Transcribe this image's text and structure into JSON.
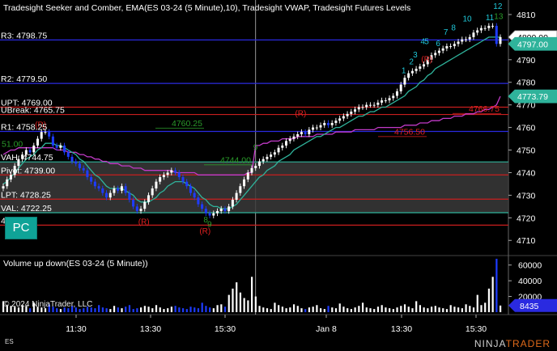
{
  "chart_title": "Tradesight Seeker and Comber, EMA(ES 03-24 (5 Minute),10), Tradesight VWAP, Tradesight Futures Levels",
  "volume_title": "Volume up down(ES 03-24 (5 Minute))",
  "copyright": "© 2024 NinjaTrader, LLC",
  "instrument": "ES",
  "brand_prefix": "NINJA",
  "brand_suffix": "TRADER",
  "pc_badge": "PC",
  "colors": {
    "background": "#000000",
    "up_bar": "#ffffff",
    "down_bar": "#1e3cff",
    "ema": "#2fb39b",
    "vwap": "#c23ac8",
    "level_blue": "#2a2ae0",
    "level_red": "#c81e1e",
    "value_area_fill": "#3a3a3a",
    "value_area_edge": "#2fb39b",
    "seeker": "#1fc7d8",
    "comber": "#2a9a2a",
    "reversal": "#e02020",
    "last_price_badge": "#2fb39b",
    "level_badge": "#2fb39b",
    "volume_badge": "#2a2ae0"
  },
  "chart_data": {
    "type": "candlestick",
    "price_axis": {
      "range": [
        4704,
        4815
      ],
      "ticks": [
        4710,
        4720,
        4730,
        4740,
        4750,
        4760,
        4770,
        4780,
        4790,
        4800,
        4810
      ],
      "tick_labels": [
        "4710",
        "4720",
        "4730",
        "4740",
        "4750",
        "4760",
        "4770",
        "4780",
        "4790",
        "4800",
        "4810"
      ]
    },
    "volume_axis": {
      "range": [
        0,
        70000
      ],
      "ticks": [
        20000,
        40000,
        60000
      ],
      "tick_labels": [
        "20000",
        "40000",
        "60000"
      ]
    },
    "time_axis": {
      "labels": [
        "11:30",
        "13:30",
        "15:30",
        "Jan 8",
        "13:30",
        "15:30"
      ]
    },
    "price_badges": [
      {
        "text": "4800.00",
        "value": 4800.0,
        "style": "last"
      },
      {
        "text": "4797.00",
        "value": 4797.0,
        "style": "ghost"
      },
      {
        "text": "4773.79",
        "value": 4773.79,
        "style": "level"
      }
    ],
    "volume_badge": {
      "text": "8435",
      "value": 8435
    },
    "levels": [
      {
        "label": "R3: 4798.75",
        "value": 4798.75,
        "color": "blue"
      },
      {
        "label": "R2: 4779.50",
        "value": 4779.5,
        "color": "blue"
      },
      {
        "label": "UPT: 4769.00",
        "value": 4769.0,
        "color": "red"
      },
      {
        "label": "UBreak: 4765.75",
        "value": 4765.75,
        "color": "red"
      },
      {
        "label": "R1: 4758.25",
        "value": 4758.25,
        "color": "blue"
      },
      {
        "label": "VAH: 4744.75",
        "value": 4744.75,
        "color": "teal"
      },
      {
        "label": "Pivot: 4739.00",
        "value": 4739.0,
        "color": "red"
      },
      {
        "label": "LPT: 4728.25",
        "value": 4728.25,
        "color": "red"
      },
      {
        "label": "VAL: 4722.25",
        "value": 4722.25,
        "color": "teal"
      },
      {
        "label": "4716.75",
        "value": 4716.75,
        "color": "red"
      }
    ],
    "annotations": [
      {
        "text": "4760.25",
        "value": 4760.25,
        "color": "green"
      },
      {
        "text": "4744.00",
        "value": 4744.0,
        "color": "green"
      },
      {
        "text": "4756.50",
        "value": 4756.5,
        "color": "red"
      },
      {
        "text": "4766.75",
        "value": 4766.75,
        "color": "red"
      },
      {
        "text": "51.00",
        "value": 4751.0,
        "color": "green"
      }
    ],
    "seeker_counts": [
      {
        "text": "12",
        "bar": 129,
        "value": 4812.5
      },
      {
        "text": "11",
        "bar": 127,
        "value": 4807.5
      },
      {
        "text": "10",
        "bar": 121,
        "value": 4807
      },
      {
        "text": "8",
        "bar": 118,
        "value": 4803
      },
      {
        "text": "7",
        "bar": 116,
        "value": 4801
      },
      {
        "text": "6",
        "bar": 114,
        "value": 4796
      },
      {
        "text": "5",
        "bar": 111,
        "value": 4797
      },
      {
        "text": "4",
        "bar": 110,
        "value": 4797
      },
      {
        "text": "3",
        "bar": 108,
        "value": 4791
      },
      {
        "text": "2",
        "bar": 107,
        "value": 4788
      },
      {
        "text": "1",
        "bar": 105,
        "value": 4784
      }
    ],
    "comber_counts": [
      {
        "text": "13",
        "bar": 129,
        "value": 4808
      },
      {
        "text": "9",
        "bar": 66,
        "value": 4750
      },
      {
        "text": "8",
        "bar": 53,
        "value": 4718
      },
      {
        "text": "9",
        "bar": 54,
        "value": 4716
      }
    ],
    "reversals": [
      {
        "text": "(R)",
        "bar": 10,
        "value": 4760
      },
      {
        "text": "(R)",
        "bar": 37,
        "value": 4717
      },
      {
        "text": "(R)",
        "bar": 53,
        "value": 4713
      },
      {
        "text": "(R)",
        "bar": 78,
        "value": 4765
      },
      {
        "text": "(R)",
        "bar": 111,
        "value": 4789
      }
    ],
    "session_divider_bar": 66,
    "bar_count": 131,
    "closes": [
      4734,
      4737,
      4739,
      4743,
      4746,
      4748,
      4750,
      4749,
      4752,
      4755,
      4758,
      4758,
      4756,
      4752,
      4751,
      4752,
      4749,
      4747,
      4745,
      4744,
      4742,
      4741,
      4738,
      4736,
      4734,
      4733,
      4731,
      4729,
      4731,
      4733,
      4732,
      4734,
      4731,
      4728,
      4725,
      4723,
      4724,
      4727,
      4730,
      4733,
      4736,
      4738,
      4739,
      4740,
      4741,
      4740,
      4738,
      4736,
      4734,
      4731,
      4729,
      4726,
      4724,
      4722,
      4721,
      4722,
      4723,
      4724,
      4723,
      4725,
      4728,
      4731,
      4734,
      4737,
      4740,
      4742,
      4743,
      4745,
      4746,
      4747,
      4748,
      4749,
      4751,
      4752,
      4754,
      4755,
      4756,
      4757,
      4758,
      4757,
      4759,
      4760,
      4760,
      4761,
      4762,
      4761,
      4762,
      4763,
      4764,
      4765,
      4766,
      4767,
      4768,
      4769,
      4769,
      4770,
      4770,
      4770,
      4771,
      4772,
      4772,
      4773,
      4774,
      4776,
      4779,
      4782,
      4784,
      4785,
      4786,
      4787,
      4788,
      4790,
      4792,
      4793,
      4794,
      4795,
      4796,
      4796,
      4797,
      4798,
      4799,
      4799,
      4800,
      4802,
      4803,
      4804,
      4804,
      4805,
      4805,
      4797,
      4800
    ],
    "ema_values": [
      4735,
      4736,
      4738,
      4740,
      4742,
      4744,
      4746,
      4747,
      4748,
      4750,
      4751,
      4753,
      4753,
      4753,
      4752,
      4752,
      4751,
      4750,
      4749,
      4748,
      4746,
      4745,
      4743,
      4741,
      4739,
      4738,
      4736,
      4734,
      4733,
      4733,
      4733,
      4733,
      4732,
      4731,
      4730,
      4728,
      4727,
      4727,
      4727,
      4728,
      4729,
      4731,
      4732,
      4734,
      4735,
      4736,
      4736,
      4736,
      4735,
      4734,
      4733,
      4731,
      4729,
      4728,
      4726,
      4725,
      4725,
      4724,
      4724,
      4724,
      4725,
      4726,
      4728,
      4730,
      4732,
      4734,
      4736,
      4738,
      4739,
      4741,
      4742,
      4743,
      4745,
      4746,
      4747,
      4748,
      4750,
      4751,
      4752,
      4753,
      4754,
      4755,
      4756,
      4756,
      4757,
      4758,
      4759,
      4760,
      4760,
      4761,
      4762,
      4763,
      4764,
      4765,
      4765,
      4766,
      4767,
      4767,
      4768,
      4769,
      4769,
      4770,
      4771,
      4772,
      4773,
      4774,
      4776,
      4777,
      4778,
      4780,
      4781,
      4783,
      4784,
      4786,
      4787,
      4788,
      4789,
      4790,
      4791,
      4792,
      4793,
      4794,
      4795,
      4796,
      4797,
      4798,
      4799,
      4800,
      4800,
      4800,
      4800
    ],
    "vwap_values": [
      4748,
      4749,
      4750,
      4750,
      4751,
      4751,
      4751,
      4751,
      4751,
      4751,
      4751,
      4751,
      4751,
      4751,
      4750,
      4750,
      4750,
      4749,
      4749,
      4749,
      4748,
      4748,
      4747,
      4747,
      4746,
      4746,
      4745,
      4745,
      4744,
      4744,
      4744,
      4743,
      4743,
      4743,
      4742,
      4742,
      4742,
      4741,
      4741,
      4741,
      4741,
      4741,
      4741,
      4741,
      4741,
      4740,
      4740,
      4740,
      4740,
      4740,
      4740,
      4739,
      4739,
      4739,
      4739,
      4739,
      4739,
      4739,
      4739,
      4739,
      4739,
      4739,
      4739,
      4739,
      4740,
      4740,
      4752,
      4752,
      4753,
      4753,
      4754,
      4754,
      4754,
      4755,
      4755,
      4755,
      4755,
      4756,
      4756,
      4756,
      4756,
      4756,
      4757,
      4757,
      4757,
      4757,
      4757,
      4758,
      4758,
      4758,
      4758,
      4758,
      4759,
      4759,
      4759,
      4759,
      4759,
      4759,
      4760,
      4760,
      4760,
      4760,
      4760,
      4760,
      4760,
      4761,
      4761,
      4761,
      4761,
      4762,
      4762,
      4762,
      4763,
      4763,
      4763,
      4764,
      4764,
      4764,
      4765,
      4765,
      4765,
      4766,
      4766,
      4766,
      4767,
      4767,
      4768,
      4768,
      4769,
      4770,
      4773.79
    ],
    "volumes": [
      14000,
      9000,
      8000,
      7000,
      6000,
      9000,
      8000,
      5000,
      12000,
      7000,
      6000,
      5000,
      10000,
      7000,
      5000,
      4000,
      6000,
      5000,
      8000,
      6000,
      4000,
      5000,
      7000,
      6000,
      5000,
      9000,
      6000,
      5000,
      4000,
      8000,
      6000,
      5000,
      7000,
      9000,
      4000,
      5000,
      6000,
      8000,
      7000,
      5000,
      9000,
      6000,
      4000,
      5000,
      7000,
      8000,
      6000,
      5000,
      4000,
      7000,
      6000,
      5000,
      12000,
      8000,
      6000,
      5000,
      9000,
      10000,
      7000,
      22000,
      30000,
      38000,
      25000,
      18000,
      15000,
      45000,
      20000,
      8000,
      6000,
      5000,
      4000,
      12000,
      9000,
      7000,
      5000,
      6000,
      10000,
      8000,
      5000,
      4000,
      6000,
      7000,
      9000,
      5000,
      4000,
      8000,
      6000,
      5000,
      11000,
      7000,
      5000,
      4000,
      6000,
      8000,
      12000,
      6000,
      5000,
      4000,
      7000,
      9000,
      6000,
      5000,
      4000,
      6000,
      8000,
      10000,
      7000,
      5000,
      14000,
      9000,
      6000,
      5000,
      7000,
      8000,
      6000,
      5000,
      4000,
      9000,
      7000,
      6000,
      5000,
      10000,
      8000,
      6000,
      22000,
      9000,
      12000,
      30000,
      45000,
      68000,
      8435
    ]
  }
}
